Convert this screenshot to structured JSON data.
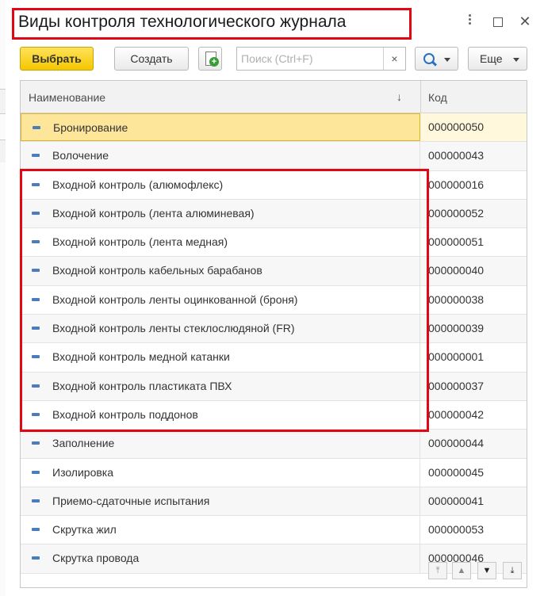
{
  "window": {
    "title": "Виды контроля технологического журнала",
    "controls": [
      "more-icon",
      "maximize-icon",
      "close-icon"
    ],
    "close_glyph": "✕"
  },
  "toolbar": {
    "select_label": "Выбрать",
    "create_label": "Создать",
    "search_placeholder": "Поиск (Ctrl+F)",
    "search_clear": "×",
    "more_label": "Еще"
  },
  "table": {
    "columns": [
      "Наименование",
      "Код"
    ],
    "sort_indicator": "↓",
    "rows": [
      {
        "name": "Бронирование",
        "code": "000000050"
      },
      {
        "name": "Волочение",
        "code": "000000043"
      },
      {
        "name": "Входной контроль (алюмофлекс)",
        "code": "000000016"
      },
      {
        "name": "Входной контроль (лента алюминевая)",
        "code": "000000052"
      },
      {
        "name": "Входной контроль (лента медная)",
        "code": "000000051"
      },
      {
        "name": "Входной контроль кабельных барабанов",
        "code": "000000040"
      },
      {
        "name": "Входной контроль ленты оцинкованной (броня)",
        "code": "000000038"
      },
      {
        "name": "Входной контроль ленты стеклослюдяной (FR)",
        "code": "000000039"
      },
      {
        "name": "Входной контроль медной катанки",
        "code": "000000001"
      },
      {
        "name": "Входной контроль пластиката ПВХ",
        "code": "000000037"
      },
      {
        "name": "Входной контроль поддонов",
        "code": "000000042"
      },
      {
        "name": "Заполнение",
        "code": "000000044"
      },
      {
        "name": "Изолировка",
        "code": "000000045"
      },
      {
        "name": "Приемо-сдаточные испытания",
        "code": "000000041"
      },
      {
        "name": "Скрутка жил",
        "code": "000000053"
      },
      {
        "name": "Скрутка провода",
        "code": "000000046"
      }
    ]
  },
  "pager": [
    "first-page-icon",
    "prev-page-icon",
    "next-page-icon",
    "last-page-icon"
  ],
  "colors": {
    "accent_select": "#f5c700",
    "highlight_border": "#e30613",
    "row_icon": "#4a7dbd"
  }
}
